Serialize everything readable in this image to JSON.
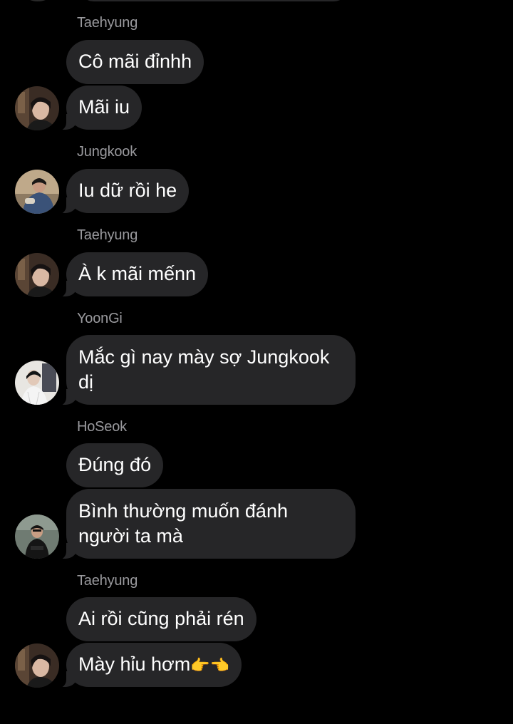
{
  "colors": {
    "background": "#000000",
    "bubble": "#262628",
    "sender_name": "#9a9a9e",
    "text": "#ffffff"
  },
  "messages": [
    {
      "sender": "Taehyung",
      "lines": [
        "Cô mãi đỉnhh",
        "Mãi iu"
      ],
      "avatar": "taehyung-avatar"
    },
    {
      "sender": "Jungkook",
      "lines": [
        "Iu dữ rồi he"
      ],
      "avatar": "jungkook-avatar"
    },
    {
      "sender": "Taehyung",
      "lines": [
        "À k mãi mếnn"
      ],
      "avatar": "taehyung-avatar"
    },
    {
      "sender": "YoonGi",
      "lines": [
        "Mắc gì nay mày sợ Jungkook dị"
      ],
      "avatar": "yoongi-avatar"
    },
    {
      "sender": "HoSeok",
      "lines": [
        "Đúng đó",
        "Bình thường muốn đánh người ta mà"
      ],
      "avatar": "hoseok-avatar"
    },
    {
      "sender": "Taehyung",
      "lines": [
        "Ai rồi cũng phải rén",
        "Mày hỉu hơm"
      ],
      "avatar": "taehyung-avatar",
      "last_emoji": "👉👈"
    }
  ]
}
